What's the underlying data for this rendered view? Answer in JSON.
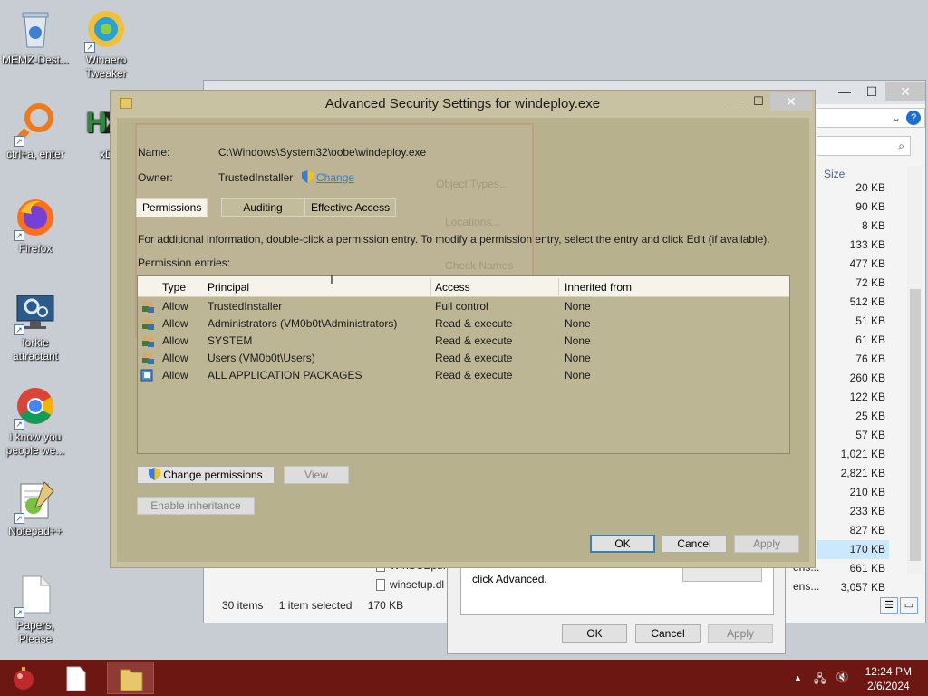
{
  "desktop": {
    "icons": [
      {
        "label": "MEMZ-Dest...",
        "icon": "recycle-bin-icon"
      },
      {
        "label": "Winaero Tweaker",
        "icon": "winaero-icon"
      },
      {
        "label": "ctrl+a, enter",
        "icon": "magnifier-icon"
      },
      {
        "label": "xD",
        "icon": "hex-editor-icon"
      },
      {
        "label": "Firefox",
        "icon": "firefox-icon"
      },
      {
        "label": "forkie attractant",
        "icon": "computer-settings-icon"
      },
      {
        "label": "i know you people we...",
        "icon": "chrome-icon"
      },
      {
        "label": "Notepad++",
        "icon": "notepadpp-icon"
      },
      {
        "label": "Papers, Please",
        "icon": "document-icon"
      }
    ]
  },
  "explorer": {
    "size_header": "Size",
    "sizes": [
      "20 KB",
      "90 KB",
      "8 KB",
      "133 KB",
      "477 KB",
      "72 KB",
      "512 KB",
      "51 KB",
      "61 KB",
      "76 KB",
      "260 KB",
      "122 KB",
      "25 KB",
      "57 KB",
      "1,021 KB",
      "2,821 KB",
      "210 KB",
      "233 KB",
      "827 KB",
      "170 KB",
      "661 KB",
      "3,057 KB"
    ],
    "selected_size_index": 19,
    "files": [
      {
        "name": "WinSCEpt..."
      },
      {
        "name": "winsetup.dl"
      }
    ],
    "side_labels": [
      "ens...",
      "ens..."
    ],
    "status": {
      "items": "30 items",
      "selected": "1 item selected",
      "size": "170 KB"
    }
  },
  "properties_dialog": {
    "text": "click Advanced.",
    "ok": "OK",
    "cancel": "Cancel",
    "apply": "Apply"
  },
  "dialog": {
    "title": "Advanced Security Settings for windeploy.exe",
    "name_label": "Name:",
    "name_value": "C:\\Windows\\System32\\oobe\\windeploy.exe",
    "owner_label": "Owner:",
    "owner_value": "TrustedInstaller",
    "change_link": "Change",
    "tabs": [
      "Permissions",
      "Auditing",
      "Effective Access"
    ],
    "info": "For additional information, double-click a permission entry. To modify a permission entry, select the entry and click Edit (if available).",
    "entries_label": "Permission entries:",
    "columns": [
      "Type",
      "Principal",
      "Access",
      "Inherited from"
    ],
    "rows": [
      {
        "type": "Allow",
        "principal": "TrustedInstaller",
        "access": "Full control",
        "inherited": "None"
      },
      {
        "type": "Allow",
        "principal": "Administrators (VM0b0t\\Administrators)",
        "access": "Read & execute",
        "inherited": "None"
      },
      {
        "type": "Allow",
        "principal": "SYSTEM",
        "access": "Read & execute",
        "inherited": "None"
      },
      {
        "type": "Allow",
        "principal": "Users (VM0b0t\\Users)",
        "access": "Read & execute",
        "inherited": "None"
      },
      {
        "type": "Allow",
        "principal": "ALL APPLICATION PACKAGES",
        "access": "Read & execute",
        "inherited": "None"
      }
    ],
    "change_permissions": "Change permissions",
    "view": "View",
    "enable_inheritance": "Enable inheritance",
    "ok": "OK",
    "cancel": "Cancel",
    "apply": "Apply"
  },
  "ghost_dialog": {
    "object_types": "Object Types...",
    "locations": "Locations...",
    "check_names": "Check Names"
  },
  "taskbar": {
    "time": "12:24 PM",
    "date": "2/6/2024"
  },
  "colors": {
    "dialog_bg": "#c8c2a2",
    "taskbar": "#6d1713"
  }
}
